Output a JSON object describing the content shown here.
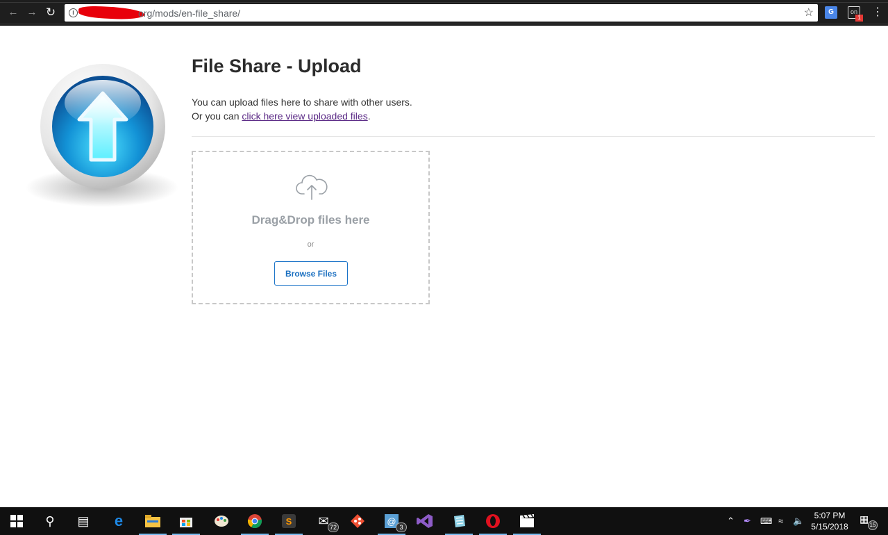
{
  "browser": {
    "url_visible": "org/mods/en-file_share/",
    "icons": [
      "back-arrow-icon",
      "forward-arrow-icon",
      "reload-icon",
      "info-icon",
      "star-icon",
      "translate-icon",
      "extension-icon",
      "menu-dots-icon"
    ],
    "extension_badge": "1"
  },
  "page": {
    "title": "File Share - Upload",
    "intro_line1": "You can upload files here to share with other users.",
    "intro_line2_prefix": "Or you can ",
    "intro_link": "click here view uploaded files",
    "intro_line2_suffix": "."
  },
  "dropzone": {
    "icon": "cloud-upload-icon",
    "heading": "Drag&Drop files here",
    "or_text": "or",
    "browse_label": "Browse Files"
  },
  "colors": {
    "accent_button": "#1a6fc0",
    "link_visited": "#5b2a86",
    "logo_blue": "#1e90d8"
  },
  "taskbar": {
    "mail_badge": "72",
    "app_badge": "3",
    "notification_count": "15",
    "time": "5:07 PM",
    "date": "5/15/2018"
  }
}
